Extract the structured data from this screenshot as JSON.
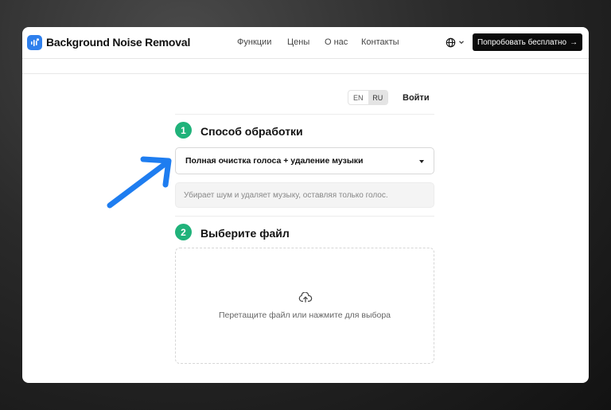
{
  "header": {
    "brand": "Background Noise Removal",
    "nav": [
      "Функции",
      "Цены",
      "О нас",
      "Контакты"
    ],
    "cta_label": "Попробовать бесплатно",
    "cta_arrow": "→"
  },
  "lang": {
    "en": "EN",
    "ru": "RU",
    "active": "RU"
  },
  "login_label": "Войти",
  "step1": {
    "number": "1",
    "title": "Способ обработки",
    "selected": "Полная очистка голоса + удаление музыки",
    "description": "Убирает шум и удаляет музыку, оставляя только голос."
  },
  "step2": {
    "number": "2",
    "title": "Выберите файл",
    "drop_text": "Перетащите файл или нажмите для выбора"
  },
  "colors": {
    "accent": "#20b27a",
    "brand_logo": "#2f80ed",
    "cta_bg": "#0b0b0b",
    "annotation_arrow": "#1e7df0"
  },
  "icons": {
    "logo": "waveform-logo-icon",
    "language": "globe-icon",
    "dropdown": "chevron-down-icon",
    "upload": "cloud-upload-icon"
  }
}
